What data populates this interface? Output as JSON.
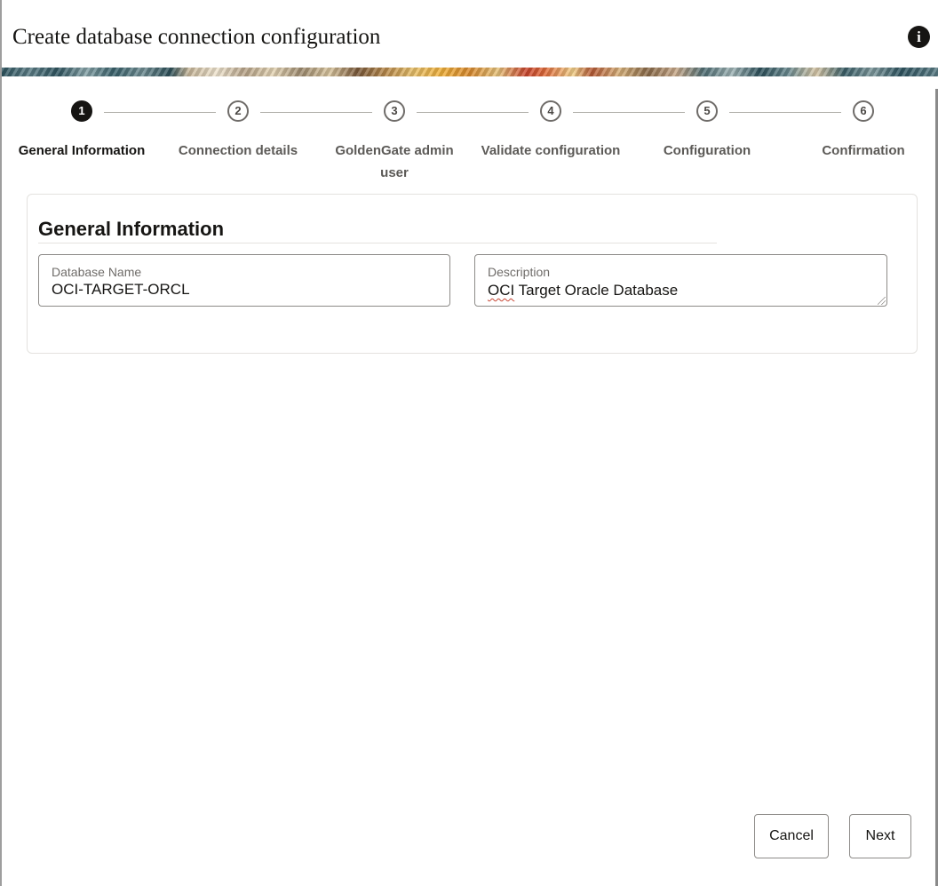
{
  "dialog": {
    "title": "Create database connection configuration",
    "info_icon": "info-icon"
  },
  "stepper": {
    "steps": [
      {
        "number": "1",
        "label": "General Information",
        "active": true
      },
      {
        "number": "2",
        "label": "Connection details",
        "active": false
      },
      {
        "number": "3",
        "label": "GoldenGate admin user",
        "active": false
      },
      {
        "number": "4",
        "label": "Validate configuration",
        "active": false
      },
      {
        "number": "5",
        "label": "Configuration",
        "active": false
      },
      {
        "number": "6",
        "label": "Confirmation",
        "active": false
      }
    ]
  },
  "form": {
    "section_title": "General Information",
    "database_name": {
      "label": "Database Name",
      "value": "OCI-TARGET-ORCL"
    },
    "description": {
      "label": "Description",
      "value_flagged": "OCI",
      "value_rest": " Target Oracle Database"
    }
  },
  "footer": {
    "cancel_label": "Cancel",
    "next_label": "Next"
  },
  "colors": {
    "active_step": "#161513",
    "inactive_step": "#6f6c69",
    "spellcheck_underline": "#c74634"
  }
}
